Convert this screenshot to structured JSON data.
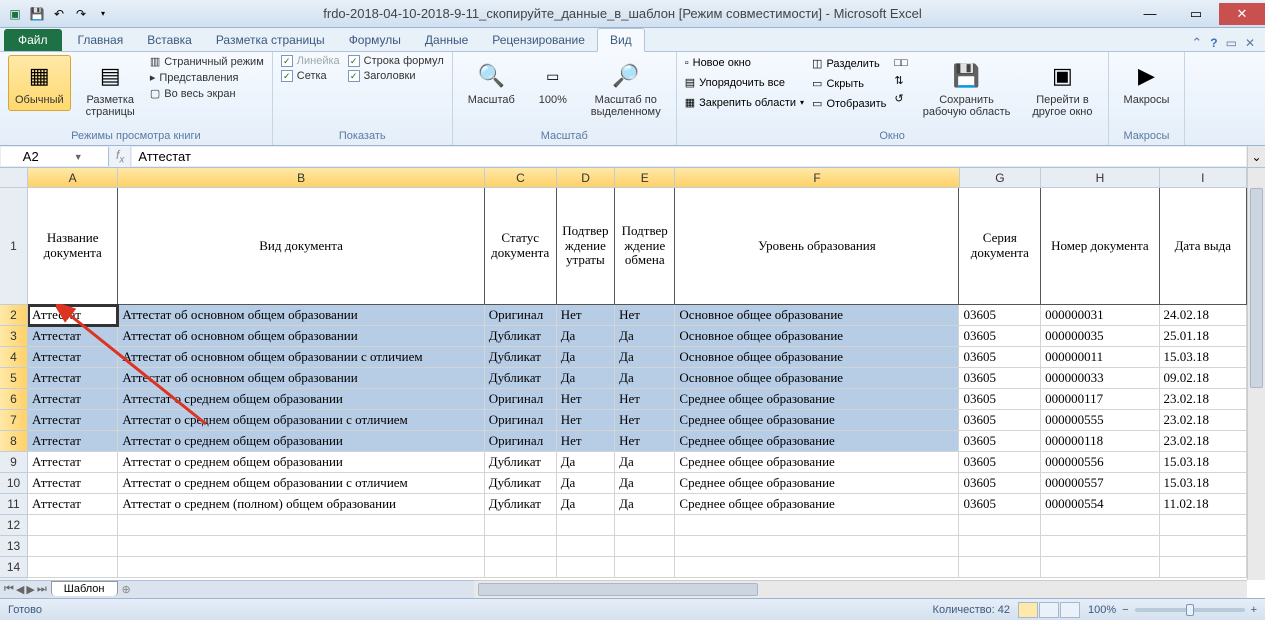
{
  "title": "frdo-2018-04-10-2018-9-11_скопируйте_данные_в_шаблон [Режим совместимости] - Microsoft Excel",
  "ribbon": {
    "file": "Файл",
    "tabs": [
      "Главная",
      "Вставка",
      "Разметка страницы",
      "Формулы",
      "Данные",
      "Рецензирование",
      "Вид"
    ],
    "active_tab": "Вид",
    "groups": {
      "views": {
        "label": "Режимы просмотра книги",
        "normal": "Обычный",
        "page_layout": "Разметка\nстраницы",
        "page_break": "Страничный режим",
        "custom": "Представления",
        "full": "Во весь экран"
      },
      "show": {
        "label": "Показать",
        "ruler": "Линейка",
        "gridlines": "Сетка",
        "formula_bar": "Строка формул",
        "headings": "Заголовки"
      },
      "zoom": {
        "label": "Масштаб",
        "zoom": "Масштаб",
        "p100": "100%",
        "to_sel": "Масштаб по\nвыделенному"
      },
      "window": {
        "label": "Окно",
        "new_win": "Новое окно",
        "arrange": "Упорядочить все",
        "freeze": "Закрепить области",
        "split": "Разделить",
        "hide": "Скрыть",
        "unhide": "Отобразить",
        "save_ws": "Сохранить\nрабочую область",
        "switch": "Перейти в\nдругое окно"
      },
      "macros": {
        "label": "Макросы",
        "macros": "Макросы"
      }
    }
  },
  "name_box": "A2",
  "formula": "Аттестат",
  "columns": [
    "A",
    "B",
    "C",
    "D",
    "E",
    "F",
    "G",
    "H",
    "I"
  ],
  "header_row_height": 117,
  "data_row_height": 21,
  "headers": [
    "Название документа",
    "Вид документа",
    "Статус документа",
    "Подтвер ждение утраты",
    "Подтвер ждение обмена",
    "Уровень образования",
    "Серия документа",
    "Номер документа",
    "Дата выда"
  ],
  "rows": [
    {
      "n": 2,
      "sel": true,
      "active": true,
      "c": [
        "Аттестат",
        "Аттестат об основном общем образовании",
        "Оригинал",
        "Нет",
        "Нет",
        "Основное общее образование",
        "03605",
        "000000031",
        "24.02.18"
      ]
    },
    {
      "n": 3,
      "sel": true,
      "c": [
        "Аттестат",
        "Аттестат об основном общем образовании",
        "Дубликат",
        "Да",
        "Да",
        "Основное общее образование",
        "03605",
        "000000035",
        "25.01.18"
      ]
    },
    {
      "n": 4,
      "sel": true,
      "c": [
        "Аттестат",
        "Аттестат об основном общем образовании с отличием",
        "Дубликат",
        "Да",
        "Да",
        "Основное общее образование",
        "03605",
        "000000011",
        "15.03.18"
      ]
    },
    {
      "n": 5,
      "sel": true,
      "c": [
        "Аттестат",
        "Аттестат об основном общем образовании",
        "Дубликат",
        "Да",
        "Да",
        "Основное общее образование",
        "03605",
        "000000033",
        "09.02.18"
      ]
    },
    {
      "n": 6,
      "sel": true,
      "c": [
        "Аттестат",
        "Аттестат о среднем общем образовании",
        "Оригинал",
        "Нет",
        "Нет",
        "Среднее общее образование",
        "03605",
        "000000117",
        "23.02.18"
      ]
    },
    {
      "n": 7,
      "sel": true,
      "c": [
        "Аттестат",
        "Аттестат о среднем общем образовании с отличием",
        "Оригинал",
        "Нет",
        "Нет",
        "Среднее общее образование",
        "03605",
        "000000555",
        "23.02.18"
      ]
    },
    {
      "n": 8,
      "sel": true,
      "c": [
        "Аттестат",
        "Аттестат о среднем общем образовании",
        "Оригинал",
        "Нет",
        "Нет",
        "Среднее общее образование",
        "03605",
        "000000118",
        "23.02.18"
      ]
    },
    {
      "n": 9,
      "c": [
        "Аттестат",
        "Аттестат о среднем общем образовании",
        "Дубликат",
        "Да",
        "Да",
        "Среднее общее образование",
        "03605",
        "000000556",
        "15.03.18"
      ]
    },
    {
      "n": 10,
      "c": [
        "Аттестат",
        "Аттестат о среднем общем образовании с отличием",
        "Дубликат",
        "Да",
        "Да",
        "Среднее общее образование",
        "03605",
        "000000557",
        "15.03.18"
      ]
    },
    {
      "n": 11,
      "c": [
        "Аттестат",
        "Аттестат о среднем (полном) общем образовании",
        "Дубликат",
        "Да",
        "Да",
        "Среднее общее образование",
        "03605",
        "000000554",
        "11.02.18"
      ]
    },
    {
      "n": 12,
      "c": [
        "",
        "",
        "",
        "",
        "",
        "",
        "",
        "",
        ""
      ]
    },
    {
      "n": 13,
      "c": [
        "",
        "",
        "",
        "",
        "",
        "",
        "",
        "",
        ""
      ]
    },
    {
      "n": 14,
      "c": [
        "",
        "",
        "",
        "",
        "",
        "",
        "",
        "",
        ""
      ]
    }
  ],
  "sheet_tab": "Шаблон",
  "status": {
    "ready": "Готово",
    "count_label": "Количество:",
    "count": "42",
    "zoom": "100%"
  }
}
